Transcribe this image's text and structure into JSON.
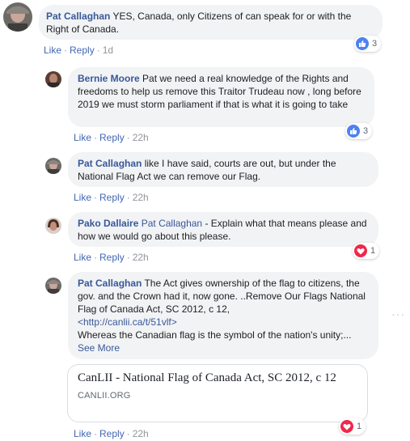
{
  "comments": [
    {
      "author": "Pat Callaghan",
      "text": " YES, Canada, only Citizens of can speak for or with the Right of Canada.",
      "like": "Like",
      "reply": "Reply",
      "time": "1d",
      "reaction_count": "3",
      "reaction": "like-icon"
    },
    {
      "author": "Bernie Moore",
      "text": " Pat we need a real knowledge of the Rights and freedoms to help us remove this Traitor Trudeau now , long before 2019 we must storm parliament if that is what it is going to take",
      "like": "Like",
      "reply": "Reply",
      "time": "22h",
      "reaction_count": "3",
      "reaction": "like-icon"
    },
    {
      "author": "Pat Callaghan",
      "text": " like I have said, courts are out, but under the National Flag Act we can remove our Flag.",
      "like": "Like",
      "reply": "Reply",
      "time": "22h"
    },
    {
      "author": "Pako Dallaire",
      "mention": "Pat Callaghan",
      "text": " - Explain what that means please and how we would go about this please.",
      "like": "Like",
      "reply": "Reply",
      "time": "22h",
      "reaction_count": "1",
      "reaction": "love-icon"
    },
    {
      "author": "Pat Callaghan",
      "text": " The Act gives ownership of the flag to citizens, the gov. and the Crown had it, now gone. ..Remove Our Flags National Flag of Canada Act, SC 2012, c 12,",
      "link": "<http://canlii.ca/t/51vlf>",
      "text2": "Whereas the Canadian flag is the symbol of the nation's unity;...",
      "see_more": "See More",
      "like": "Like",
      "reply": "Reply",
      "time": "22h",
      "reaction_count": "1",
      "reaction": "love-icon"
    }
  ],
  "preview": {
    "title": "CanLII - National Flag of Canada Act, SC 2012, c 12",
    "domain": "CANLII.ORG"
  },
  "separator": "·",
  "more_options": "···",
  "colors": {
    "name": "#385898",
    "bubble": "#f2f3f5",
    "like_blue": "#4e82f2",
    "love_red": "#f0284a"
  }
}
